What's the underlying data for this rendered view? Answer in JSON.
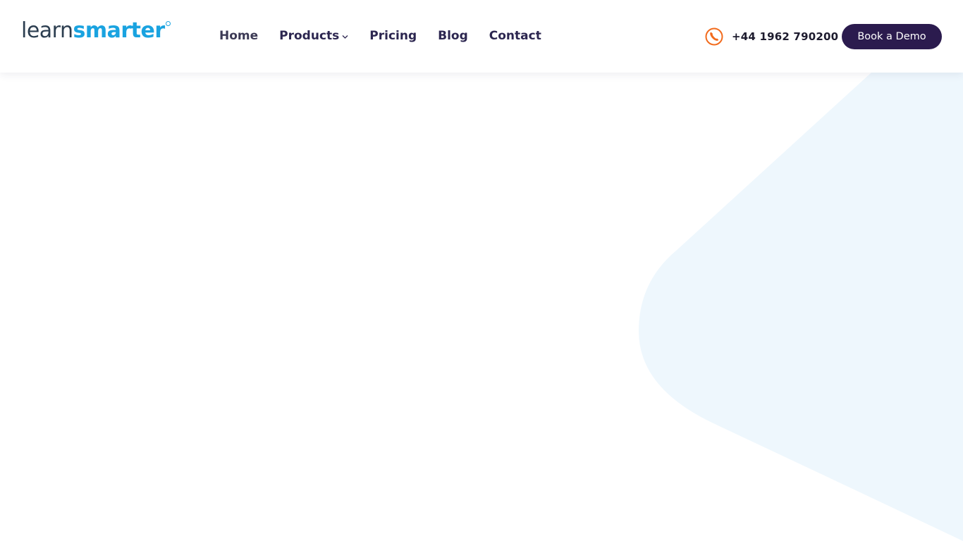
{
  "brand": {
    "logo_part1": "learn",
    "logo_part2": "smarter",
    "color_dark": "#2c3e50",
    "color_accent": "#1aa3e0"
  },
  "nav": {
    "items": [
      {
        "label": "Home"
      },
      {
        "label": "Products",
        "has_dropdown": true
      },
      {
        "label": "Pricing"
      },
      {
        "label": "Blog"
      },
      {
        "label": "Contact"
      }
    ]
  },
  "contact": {
    "phone": "+44 1962 790200",
    "icon": "phone-icon",
    "icon_color": "#f26b1d"
  },
  "cta": {
    "label": "Book a Demo",
    "color": "#2b1b4e"
  },
  "hero": {
    "background_shape_color": "#eef7fd"
  }
}
